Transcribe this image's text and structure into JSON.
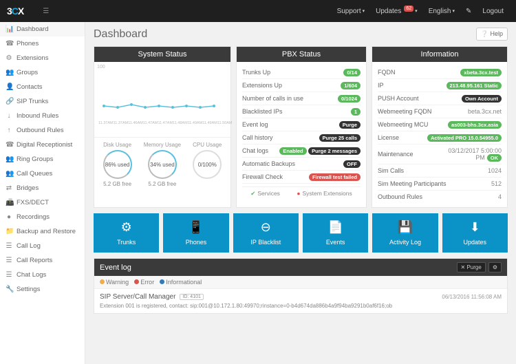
{
  "top": {
    "support": "Support",
    "updates": "Updates",
    "updates_badge": "62",
    "english": "English",
    "edit": "✎",
    "logout": "Logout"
  },
  "nav": [
    {
      "ico": "📊",
      "label": "Dashboard",
      "active": true
    },
    {
      "ico": "☎",
      "label": "Phones"
    },
    {
      "ico": "⚙",
      "label": "Extensions"
    },
    {
      "ico": "👥",
      "label": "Groups"
    },
    {
      "ico": "👤",
      "label": "Contacts"
    },
    {
      "ico": "🔗",
      "label": "SIP Trunks"
    },
    {
      "ico": "↓",
      "label": "Inbound Rules"
    },
    {
      "ico": "↑",
      "label": "Outbound Rules"
    },
    {
      "ico": "☎",
      "label": "Digital Receptionist"
    },
    {
      "ico": "👥",
      "label": "Ring Groups"
    },
    {
      "ico": "👥",
      "label": "Call Queues"
    },
    {
      "ico": "⇄",
      "label": "Bridges"
    },
    {
      "ico": "📠",
      "label": "FXS/DECT"
    },
    {
      "ico": "●",
      "label": "Recordings"
    },
    {
      "ico": "📁",
      "label": "Backup and Restore"
    },
    {
      "ico": "☰",
      "label": "Call Log"
    },
    {
      "ico": "☰",
      "label": "Call Reports"
    },
    {
      "ico": "☰",
      "label": "Chat Logs"
    },
    {
      "ico": "🔧",
      "label": "Settings"
    }
  ],
  "title": "Dashboard",
  "help": "Help",
  "sys": {
    "head": "System Status",
    "disk_h": "Disk Usage",
    "mem_h": "Memory Usage",
    "cpu_h": "CPU Usage",
    "disk_v": "86% used",
    "mem_v": "34% used",
    "cpu_v": "0/100%",
    "disk_f": "5.2 GB free",
    "mem_f": "5.2 GB free",
    "xticks": [
      "11.37AM",
      "11.37AM",
      "11.46AM",
      "11.47AM",
      "11.47AM",
      "11.48AM",
      "11.49AM",
      "11.49AM",
      "11.50AM"
    ],
    "ymax": "100"
  },
  "pbx": {
    "head": "PBX Status",
    "rows": [
      {
        "k": "Trunks Up",
        "v": "0/14",
        "c": "green"
      },
      {
        "k": "Extensions Up",
        "v": "1/604",
        "c": "green"
      },
      {
        "k": "Number of calls in use",
        "v": "0/1024",
        "c": "green"
      },
      {
        "k": "Blacklisted IPs",
        "v": "1",
        "c": "green"
      },
      {
        "k": "Event log",
        "v": "Purge",
        "c": "dark"
      },
      {
        "k": "Call history",
        "v": "Purge 25 calls",
        "c": "dark"
      },
      {
        "k": "Chat logs",
        "v": "Enabled",
        "c": "green",
        "v2": "Purge 2 messages",
        "c2": "dark"
      },
      {
        "k": "Automatic Backups",
        "v": "OFF",
        "c": "dark"
      },
      {
        "k": "Firewall Check",
        "v": "Firewall test failed",
        "c": "red"
      }
    ],
    "svc_ok": "Services",
    "svc_bad": "System Extensions"
  },
  "info": {
    "head": "Information",
    "rows": [
      {
        "k": "FQDN",
        "v": "xbeta.3cx.test",
        "c": "green"
      },
      {
        "k": "IP",
        "v": "213.48.95.161 Static",
        "c": "green"
      },
      {
        "k": "PUSH Account",
        "v": "Own Account",
        "c": "dark"
      },
      {
        "k": "Webmeeting FQDN",
        "v": "beta.3cx.net",
        "plain": true
      },
      {
        "k": "Webmeeting MCU",
        "v": "as003-bhs.3cx.asia",
        "c": "green"
      },
      {
        "k": "License",
        "v": "Activated PRO 15.0.54955.0",
        "c": "green"
      },
      {
        "k": "Maintenance",
        "v": "03/12/2017 5:00:00 PM",
        "plain": true,
        "v2": "OK",
        "c2": "green"
      },
      {
        "k": "Sim Calls",
        "v": "1024",
        "plain": true
      },
      {
        "k": "Sim Meeting Participants",
        "v": "512",
        "plain": true
      },
      {
        "k": "Outbound Rules",
        "v": "4",
        "plain": true
      }
    ]
  },
  "tiles": [
    {
      "ico": "⚙",
      "label": "Trunks"
    },
    {
      "ico": "📱",
      "label": "Phones"
    },
    {
      "ico": "⊖",
      "label": "IP Blacklist"
    },
    {
      "ico": "📄",
      "label": "Events"
    },
    {
      "ico": "💾",
      "label": "Activity Log"
    },
    {
      "ico": "⬇",
      "label": "Updates"
    }
  ],
  "ev": {
    "head": "Event log",
    "purge": "Purge",
    "warn": "Warning",
    "err": "Error",
    "info": "Informational",
    "items": [
      {
        "title": "SIP Server/Call Manager",
        "id": "ID: 4101",
        "time": "06/13/2016 11:56:08 AM",
        "desc": "Extension 001 is registered, contact: sip:001@10.172.1.80:49970;rinstance=0-b4d674da886b4a9f94ba9291b0af6f16;ob"
      }
    ]
  }
}
